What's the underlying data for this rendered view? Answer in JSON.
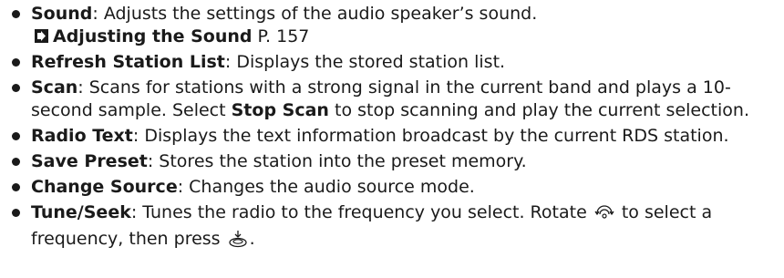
{
  "items": [
    {
      "term": "Sound",
      "desc": ": Adjusts the settings of the audio speaker’s sound.",
      "ref": {
        "title": "Adjusting the Sound",
        "page": "P. 157"
      }
    },
    {
      "term": "Refresh Station List",
      "desc": ": Displays the stored station list."
    },
    {
      "term": "Scan",
      "desc_a": ": Scans for stations with a strong signal in the current band and plays a 10-second sample. Select ",
      "emph": "Stop Scan",
      "desc_b": " to stop scanning and play the current selection."
    },
    {
      "term": "Radio Text",
      "desc": ": Displays the text information broadcast by the current RDS station."
    },
    {
      "term": "Save Preset",
      "desc": ": Stores the station into the preset memory."
    },
    {
      "term": "Change Source",
      "desc": ": Changes the audio source mode."
    },
    {
      "term": "Tune/Seek",
      "desc_a": ": Tunes the radio to the frequency you select. Rotate ",
      "icon_a": "rotate-knob-icon",
      "desc_b": " to select a frequency, then press ",
      "icon_b": "press-knob-icon",
      "desc_c": "."
    }
  ]
}
